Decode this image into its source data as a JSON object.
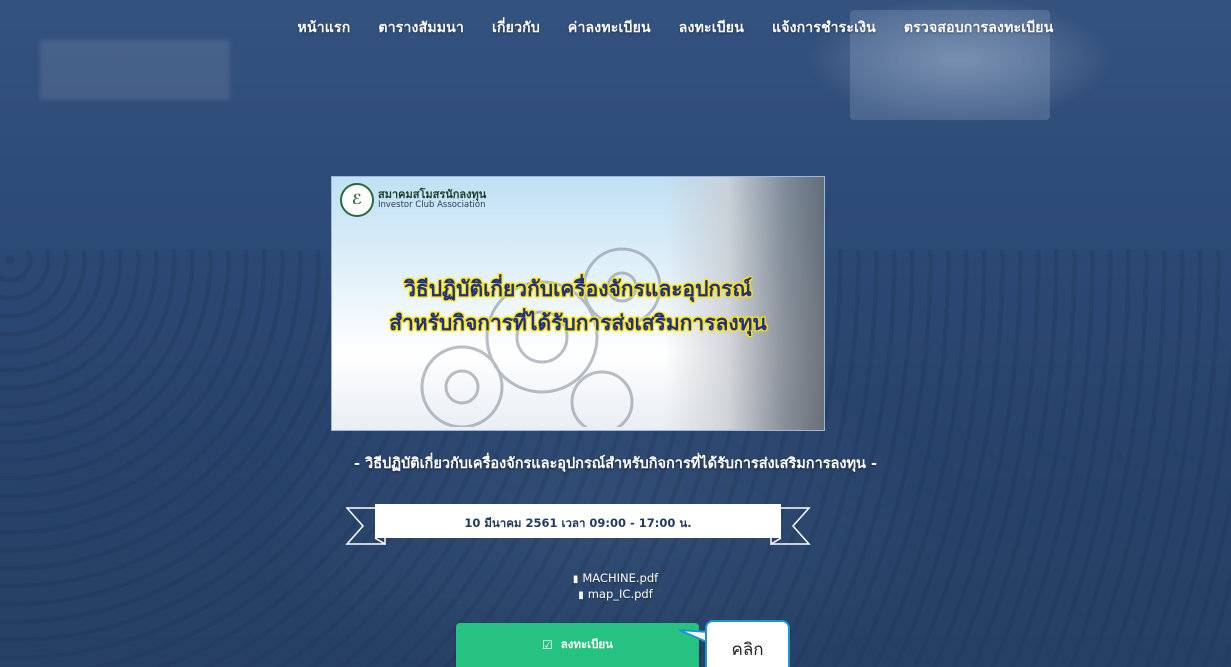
{
  "nav": {
    "items": [
      "หน้าแรก",
      "ตารางสัมมนา",
      "เกี่ยวกับ",
      "ค่าลงทะเบียน",
      "ลงทะเบียน",
      "แจ้งการชำระเงิน",
      "ตรวจสอบการลงทะเบียน"
    ]
  },
  "banner": {
    "logo_th": "สมาคมสโมสรนักลงทุน",
    "logo_en": "Investor Club Association",
    "headline_line1": "วิธีปฏิบัติเกี่ยวกับเครื่องจักรและอุปกรณ์",
    "headline_line2": "สำหรับกิจการที่ได้รับการส่งเสริมการลงทุน"
  },
  "event": {
    "subtitle": "- วิธีปฏิบัติเกี่ยวกับเครื่องจักรและอุปกรณ์สำหรับกิจการที่ได้รับการส่งเสริมการลงทุน -",
    "date_time": "10 มีนาคม 2561 เวลา 09:00 - 17:00 น."
  },
  "files": [
    {
      "name": "MACHINE.pdf",
      "icon": "file-icon"
    },
    {
      "name": "map_IC.pdf",
      "icon": "file-icon"
    }
  ],
  "register_button": {
    "label": "ลงทะเบียน",
    "icon": "check-square-icon",
    "color": "#26c281"
  },
  "callout": {
    "text": "คลิก",
    "border_color": "#1c94d6"
  }
}
